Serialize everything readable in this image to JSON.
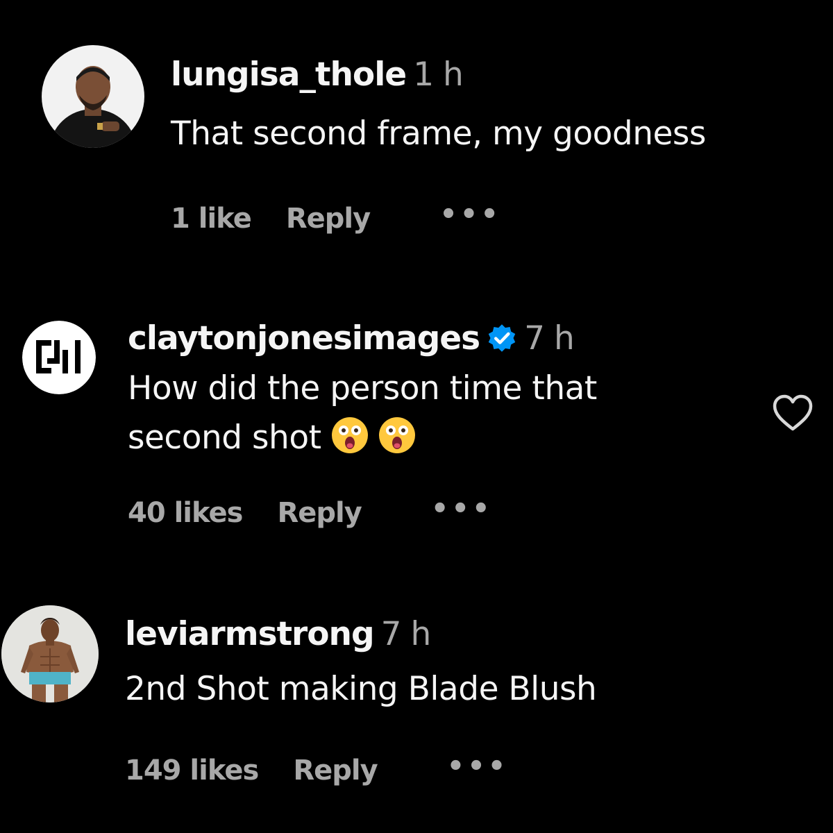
{
  "comments": [
    {
      "username": "lungisa_thole",
      "time": "1 h",
      "text_lines": [
        "That second frame, my goodness"
      ],
      "likes": "1 like",
      "reply_label": "Reply",
      "more_label": "•••",
      "verified": false,
      "avatar_icon": "profile-photo-avatar"
    },
    {
      "username": "claytonjonesimages",
      "time": "7 h",
      "text_lines": [
        "How did the person time that",
        "second shot"
      ],
      "emojis": [
        "astonished-face-emoji",
        "astonished-face-emoji"
      ],
      "likes": "40 likes",
      "reply_label": "Reply",
      "more_label": "•••",
      "verified": true,
      "avatar_icon": "cji-logo-avatar",
      "heart_icon": "heart-outline-icon"
    },
    {
      "username": "leviarmstrong",
      "time": "7 h",
      "text_lines": [
        "2nd Shot making Blade Blush"
      ],
      "likes": "149 likes",
      "reply_label": "Reply",
      "more_label": "•••",
      "verified": false,
      "avatar_icon": "profile-photo-avatar"
    }
  ],
  "colors": {
    "background": "#000000",
    "primary_text": "#f5f5f5",
    "secondary_text": "#a8a8a8",
    "verified_badge": "#0095f6"
  }
}
